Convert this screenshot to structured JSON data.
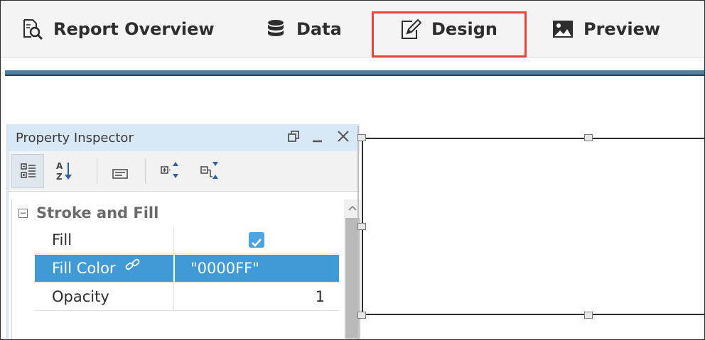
{
  "tabs": [
    {
      "label": "Report Overview",
      "icon": "report-overview-icon"
    },
    {
      "label": "Data",
      "icon": "database-icon"
    },
    {
      "label": "Design",
      "icon": "design-edit-icon"
    },
    {
      "label": "Preview",
      "icon": "image-preview-icon"
    }
  ],
  "active_tab": "Design",
  "highlight_color": "#e8453c",
  "property_inspector": {
    "title": "Property Inspector",
    "header_buttons": [
      "restore-icon",
      "minimize-icon",
      "close-icon"
    ],
    "toolbar": [
      "categorized-icon",
      "sort-alpha-icon",
      "description-icon",
      "expand-all-icon",
      "collapse-all-icon"
    ],
    "section": {
      "label": "Stroke and Fill",
      "toggle": "−"
    },
    "rows": [
      {
        "name": "Fill",
        "value": "",
        "checked": true
      },
      {
        "name": "Fill Color",
        "value": "\"0000FF\"",
        "selected": true,
        "bound": true
      },
      {
        "name": "Opacity",
        "value": "1"
      }
    ]
  },
  "selection_color": "#3f9ad6"
}
